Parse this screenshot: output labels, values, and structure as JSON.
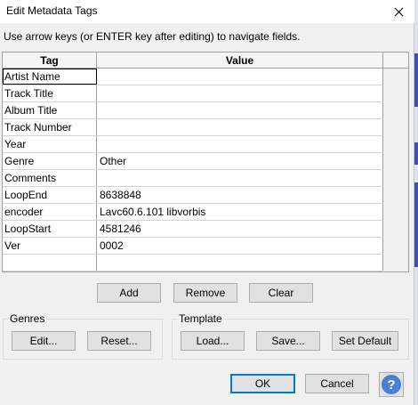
{
  "window": {
    "title": "Edit Metadata Tags"
  },
  "hint": "Use arrow keys (or ENTER key after editing) to navigate fields.",
  "table": {
    "headers": [
      "Tag",
      "Value"
    ],
    "rows": [
      {
        "tag": "Artist Name",
        "value": ""
      },
      {
        "tag": "Track Title",
        "value": ""
      },
      {
        "tag": "Album Title",
        "value": ""
      },
      {
        "tag": "Track Number",
        "value": ""
      },
      {
        "tag": "Year",
        "value": ""
      },
      {
        "tag": "Genre",
        "value": "Other"
      },
      {
        "tag": "Comments",
        "value": ""
      },
      {
        "tag": "LoopEnd",
        "value": "8638848"
      },
      {
        "tag": "encoder",
        "value": "Lavc60.6.101 libvorbis"
      },
      {
        "tag": "LoopStart",
        "value": "4581246"
      },
      {
        "tag": "Ver",
        "value": "0002"
      },
      {
        "tag": "",
        "value": ""
      }
    ]
  },
  "row_buttons": {
    "add": "Add",
    "remove": "Remove",
    "clear": "Clear"
  },
  "genres": {
    "label": "Genres",
    "edit": "Edit...",
    "reset": "Reset..."
  },
  "template": {
    "label": "Template",
    "load": "Load...",
    "save": "Save...",
    "set_default": "Set Default"
  },
  "dialog_buttons": {
    "ok": "OK",
    "cancel": "Cancel",
    "help": "?"
  },
  "icons": {
    "close": "close-icon",
    "help": "help-icon"
  },
  "colors": {
    "accent": "#0078d7",
    "help_blue": "#4a7fd6"
  }
}
